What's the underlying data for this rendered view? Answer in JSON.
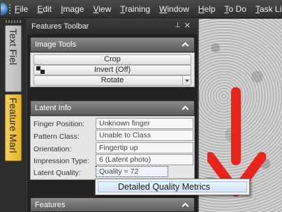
{
  "menu": {
    "items": [
      "File",
      "Edit",
      "Image",
      "View",
      "Training",
      "Window",
      "Help",
      "To Do",
      "Task List"
    ]
  },
  "vertical_tabs": [
    {
      "label": "Text Fiel"
    },
    {
      "label": "Feature Marl"
    }
  ],
  "panel": {
    "title": "Features Toolbar",
    "pin_glyph": "⊥",
    "close_glyph": "✕"
  },
  "image_tools": {
    "header": "Image Tools",
    "crop_label": "Crop",
    "invert_label": "Invert (Off)",
    "rotate_label": "Rotate"
  },
  "latent_info": {
    "header": "Latent Info",
    "fields": [
      {
        "label": "Finger Position:",
        "value": "Unknown finger"
      },
      {
        "label": "Pattern Class:",
        "value": "Unable to Class"
      },
      {
        "label": "Orientation:",
        "value": "Fingertip up"
      },
      {
        "label": "Impression Type:",
        "value": "6 (Latent photo)"
      },
      {
        "label": "Latent Quality:",
        "value": "Quality = 72"
      }
    ]
  },
  "features": {
    "header": "Features"
  },
  "context_menu": {
    "item": "Detailed Quality Metrics"
  },
  "colors": {
    "arrow": "#e8241c",
    "tab_active": "#efc23a"
  }
}
